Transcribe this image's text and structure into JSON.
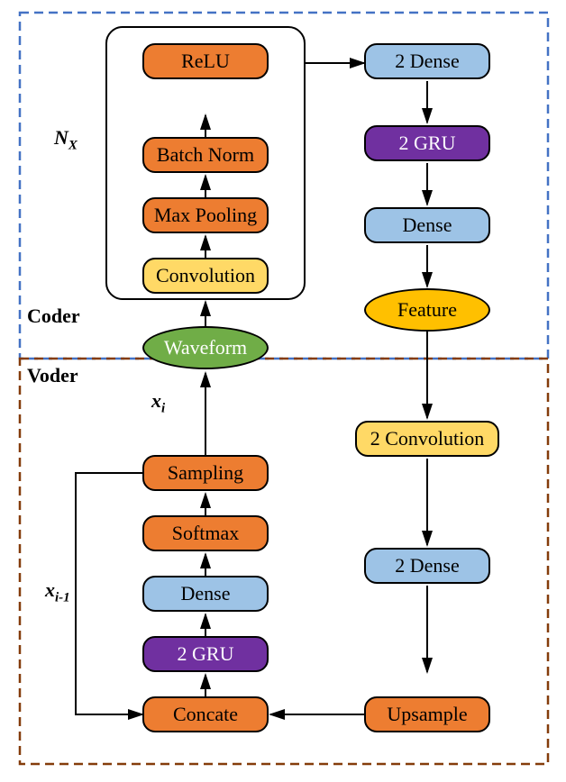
{
  "diagram": {
    "sections": {
      "coder": "Coder",
      "voder": "Voder"
    },
    "repeat_label": "N",
    "repeat_sub": "X",
    "xi": "x",
    "xi_sub": "i",
    "xi1": "x",
    "xi1_sub": "i-1",
    "nodes": {
      "relu": "ReLU",
      "batchnorm": "Batch Norm",
      "maxpool": "Max Pooling",
      "conv": "Convolution",
      "waveform": "Waveform",
      "sampling": "Sampling",
      "softmax": "Softmax",
      "dense_left": "Dense",
      "gru_left": "2 GRU",
      "concate": "Concate",
      "twodense_top": "2 Dense",
      "gru_right": "2 GRU",
      "dense_right": "Dense",
      "feature": "Feature",
      "twoconv": "2 Convolution",
      "twodense_bot": "2 Dense",
      "upsample": "Upsample"
    },
    "colors": {
      "orange": "#ed7d31",
      "yellow": "#ffd966",
      "green": "#70ad47",
      "blue": "#9dc3e6",
      "purple": "#7030a0",
      "gold": "#ffc000",
      "coder_border": "#4472c4",
      "voder_border": "#843c0b"
    }
  },
  "chart_data": {
    "type": "diagram",
    "title": "Coder / Voder neural architecture block diagram",
    "nodes": [
      {
        "id": "waveform",
        "label": "Waveform",
        "shape": "ellipse",
        "section": "coder",
        "color": "green"
      },
      {
        "id": "conv",
        "label": "Convolution",
        "shape": "roundrect",
        "section": "coder",
        "color": "yellow",
        "group": "Nx"
      },
      {
        "id": "maxpool",
        "label": "Max Pooling",
        "shape": "roundrect",
        "section": "coder",
        "color": "orange",
        "group": "Nx"
      },
      {
        "id": "batchnorm",
        "label": "Batch Norm",
        "shape": "roundrect",
        "section": "coder",
        "color": "orange",
        "group": "Nx"
      },
      {
        "id": "relu",
        "label": "ReLU",
        "shape": "roundrect",
        "section": "coder",
        "color": "orange",
        "group": "Nx"
      },
      {
        "id": "twodense_top",
        "label": "2 Dense",
        "shape": "roundrect",
        "section": "coder",
        "color": "blue"
      },
      {
        "id": "gru_right",
        "label": "2 GRU",
        "shape": "roundrect",
        "section": "coder",
        "color": "purple"
      },
      {
        "id": "dense_right",
        "label": "Dense",
        "shape": "roundrect",
        "section": "coder",
        "color": "blue"
      },
      {
        "id": "feature",
        "label": "Feature",
        "shape": "ellipse",
        "section": "coder",
        "color": "gold"
      },
      {
        "id": "twoconv",
        "label": "2 Convolution",
        "shape": "roundrect",
        "section": "voder",
        "color": "yellow"
      },
      {
        "id": "twodense_bot",
        "label": "2 Dense",
        "shape": "roundrect",
        "section": "voder",
        "color": "blue"
      },
      {
        "id": "upsample",
        "label": "Upsample",
        "shape": "roundrect",
        "section": "voder",
        "color": "orange"
      },
      {
        "id": "concate",
        "label": "Concate",
        "shape": "roundrect",
        "section": "voder",
        "color": "orange"
      },
      {
        "id": "gru_left",
        "label": "2 GRU",
        "shape": "roundrect",
        "section": "voder",
        "color": "purple"
      },
      {
        "id": "dense_left",
        "label": "Dense",
        "shape": "roundrect",
        "section": "voder",
        "color": "blue"
      },
      {
        "id": "softmax",
        "label": "Softmax",
        "shape": "roundrect",
        "section": "voder",
        "color": "orange"
      },
      {
        "id": "sampling",
        "label": "Sampling",
        "shape": "roundrect",
        "section": "voder",
        "color": "orange"
      }
    ],
    "edges": [
      {
        "from": "waveform",
        "to": "conv"
      },
      {
        "from": "conv",
        "to": "maxpool"
      },
      {
        "from": "maxpool",
        "to": "batchnorm"
      },
      {
        "from": "batchnorm",
        "to": "relu"
      },
      {
        "from": "relu",
        "to": "twodense_top"
      },
      {
        "from": "twodense_top",
        "to": "gru_right"
      },
      {
        "from": "gru_right",
        "to": "dense_right"
      },
      {
        "from": "dense_right",
        "to": "feature"
      },
      {
        "from": "feature",
        "to": "twoconv"
      },
      {
        "from": "twoconv",
        "to": "twodense_bot"
      },
      {
        "from": "twodense_bot",
        "to": "upsample"
      },
      {
        "from": "upsample",
        "to": "concate"
      },
      {
        "from": "concate",
        "to": "gru_left"
      },
      {
        "from": "gru_left",
        "to": "dense_left"
      },
      {
        "from": "dense_left",
        "to": "softmax"
      },
      {
        "from": "softmax",
        "to": "sampling"
      },
      {
        "from": "sampling",
        "to": "waveform",
        "label": "x_i"
      },
      {
        "from": "sampling",
        "to": "concate",
        "label": "x_{i-1}",
        "note": "feedback loop"
      }
    ],
    "groups": [
      {
        "id": "Nx",
        "label": "N_X",
        "members": [
          "conv",
          "maxpool",
          "batchnorm",
          "relu"
        ],
        "meaning": "repeated block"
      }
    ],
    "sections": [
      {
        "id": "coder",
        "label": "Coder",
        "border": "dashed-blue"
      },
      {
        "id": "voder",
        "label": "Voder",
        "border": "dashed-brown"
      }
    ]
  }
}
